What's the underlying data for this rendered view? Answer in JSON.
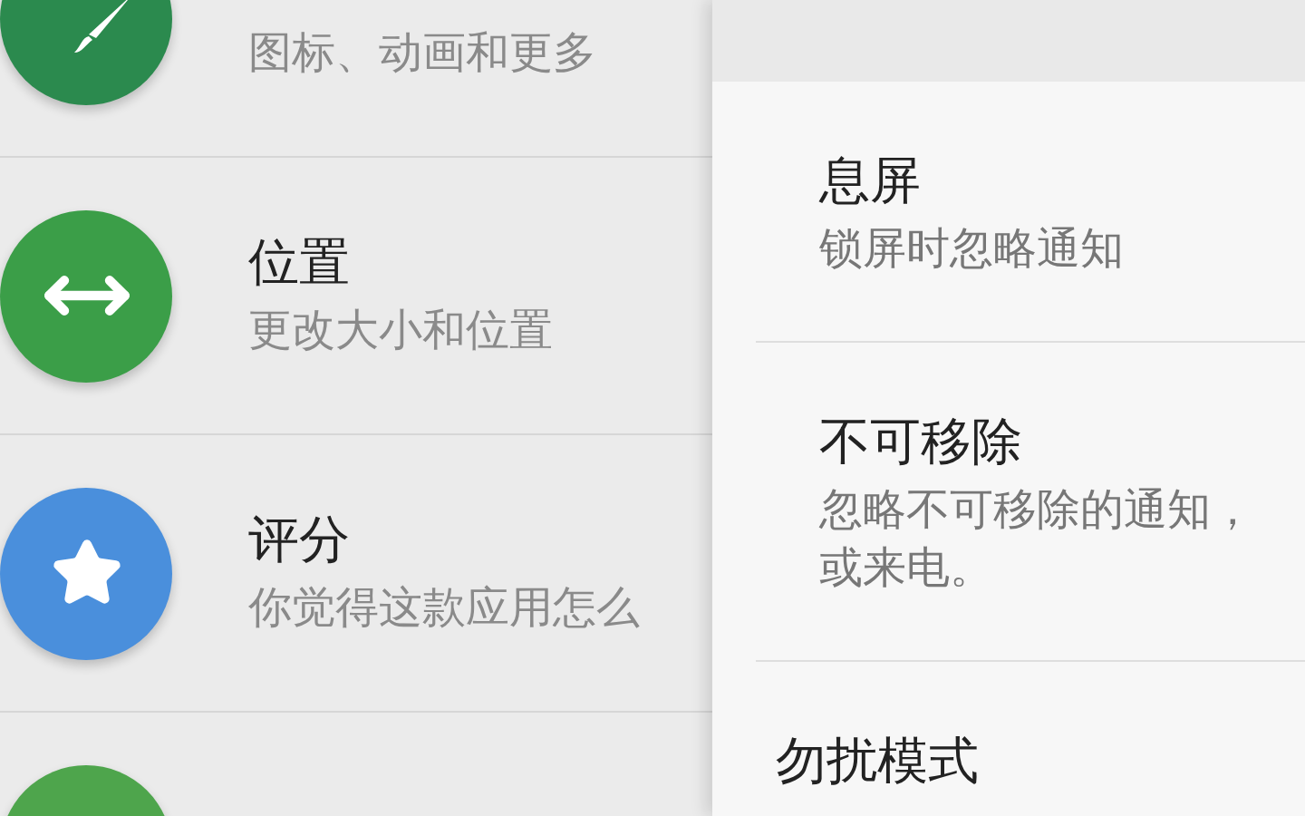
{
  "settings_list": [
    {
      "subtitle": "图标、动画和更多",
      "color": "#2b8a4e"
    },
    {
      "title": "位置",
      "subtitle": "更改大小和位置",
      "color": "#3b9e48"
    },
    {
      "title": "评分",
      "subtitle": "你觉得这款应用怎么",
      "color": "#4a8fdc"
    },
    {
      "color": "#4ea54c"
    }
  ],
  "ignore_panel": {
    "options": [
      {
        "title": "息屏",
        "summary_lines": [
          "锁屏时忽略通知"
        ]
      },
      {
        "title": "不可移除",
        "summary_lines": [
          "忽略不可移除的通知，",
          "或来电。"
        ]
      },
      {
        "title": "勿扰模式"
      }
    ]
  }
}
